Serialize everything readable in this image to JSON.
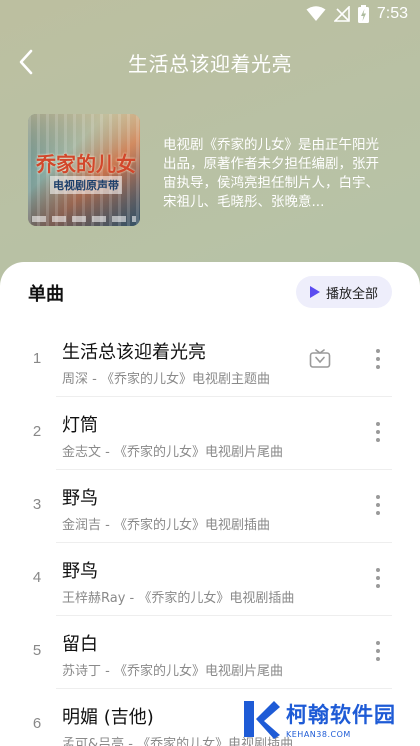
{
  "status_bar": {
    "time": "7:53",
    "icons": [
      "wifi-icon",
      "no-signal-icon",
      "battery-charging-icon"
    ]
  },
  "header": {
    "back_icon": "chevron-left-icon",
    "title": "生活总该迎着光亮"
  },
  "album": {
    "cover_title": "乔家的儿女",
    "cover_subtitle": "电视剧原声带",
    "description": "电视剧《乔家的儿女》是由正午阳光出品，原著作者未夕担任编剧，张开宙执导，侯鸿亮担任制片人，白宇、宋祖儿、毛晓彤、张晚意..."
  },
  "section": {
    "title": "单曲",
    "play_all_label": "播放全部",
    "accent_color": "#5a4bf0"
  },
  "songs": [
    {
      "index": "1",
      "title": "生活总该迎着光亮",
      "subtitle": "周深 - 《乔家的儿女》电视剧主题曲",
      "has_mv": true
    },
    {
      "index": "2",
      "title": "灯筒",
      "subtitle": "金志文 - 《乔家的儿女》电视剧片尾曲",
      "has_mv": false
    },
    {
      "index": "3",
      "title": "野鸟",
      "subtitle": "金润吉 - 《乔家的儿女》电视剧插曲",
      "has_mv": false
    },
    {
      "index": "4",
      "title": "野鸟",
      "subtitle": "王梓赫Ray - 《乔家的儿女》电视剧插曲",
      "has_mv": false
    },
    {
      "index": "5",
      "title": "留白",
      "subtitle": "苏诗丁 - 《乔家的儿女》电视剧片尾曲",
      "has_mv": false
    },
    {
      "index": "6",
      "title": "明媚 (吉他)",
      "subtitle": "孟可&吕亮 - 《乔家的儿女》电视剧插曲",
      "has_mv": false
    }
  ],
  "watermark": {
    "name": "柯翰软件园",
    "domain": "KEHAN38.COM"
  }
}
